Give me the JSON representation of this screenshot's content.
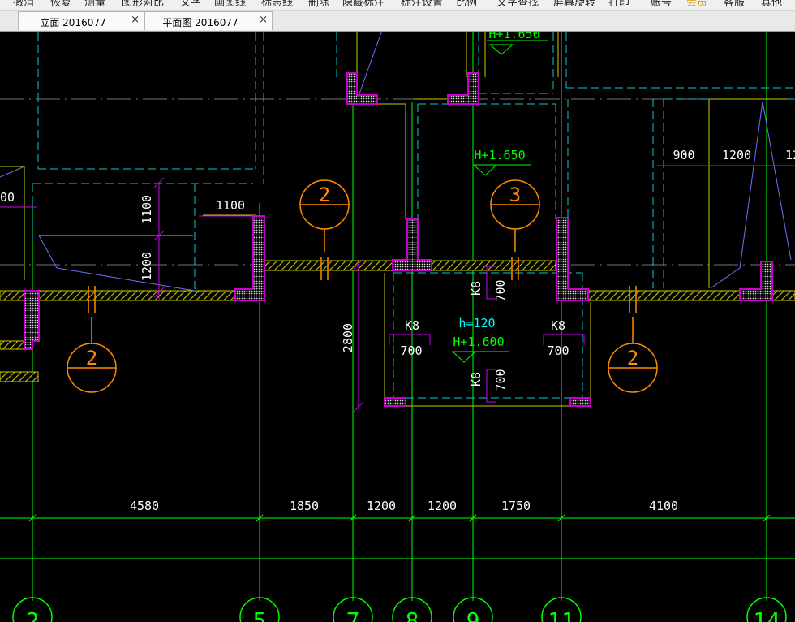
{
  "menu": {
    "items": [
      {
        "label": "撤消"
      },
      {
        "label": "恢复"
      },
      {
        "label": "测量"
      },
      {
        "label": "图形对比"
      },
      {
        "label": "文字"
      },
      {
        "label": "画图线"
      },
      {
        "label": "标志线"
      },
      {
        "label": "删除"
      },
      {
        "label": "隐藏标注"
      },
      {
        "label": "标注设置"
      },
      {
        "label": "比例"
      },
      {
        "label": "文字查找"
      },
      {
        "label": "屏幕旋转"
      },
      {
        "label": "打印"
      },
      {
        "label": "账号"
      },
      {
        "label": "会员",
        "color": "#d4a017"
      },
      {
        "label": "客服"
      },
      {
        "label": "其他"
      }
    ]
  },
  "tabs": [
    {
      "label": "立面 2016077",
      "close": "×"
    },
    {
      "label": "平面图 2016077",
      "close": "×"
    }
  ],
  "drawing": {
    "dimensions": {
      "bottom": [
        "4580",
        "1850",
        "1200",
        "1200",
        "1750",
        "4100"
      ],
      "top_right": [
        "900",
        "1200",
        "12"
      ],
      "left_partial": "00",
      "vertical": [
        "1100",
        "1200",
        "2800"
      ],
      "opening": "1100",
      "k8_700": [
        "700",
        "700",
        "700",
        "700"
      ]
    },
    "levels": [
      "H+1.650",
      "H+1.650",
      "H+1.600"
    ],
    "beam_height": "h=120",
    "rebar_labels": [
      "K8",
      "K8",
      "K8",
      "K8"
    ],
    "section_marks": [
      "2",
      "3",
      "2",
      "2"
    ],
    "axis_labels": [
      "2",
      "5",
      "7",
      "8",
      "9",
      "11",
      "14"
    ]
  },
  "colors": {
    "background": "#000000",
    "grid_axis": "#00ff00",
    "wall_hatch": "#c8c800",
    "column": "#cc00cc",
    "dashed_beam": "#00cccc",
    "section_symbol": "#ff8c00",
    "dimension_mark": "#cc00ff",
    "text": "#ffffff",
    "level_text": "#00ff00",
    "beam_text": "#00ffff",
    "thin_line": "#c8c8c8"
  }
}
